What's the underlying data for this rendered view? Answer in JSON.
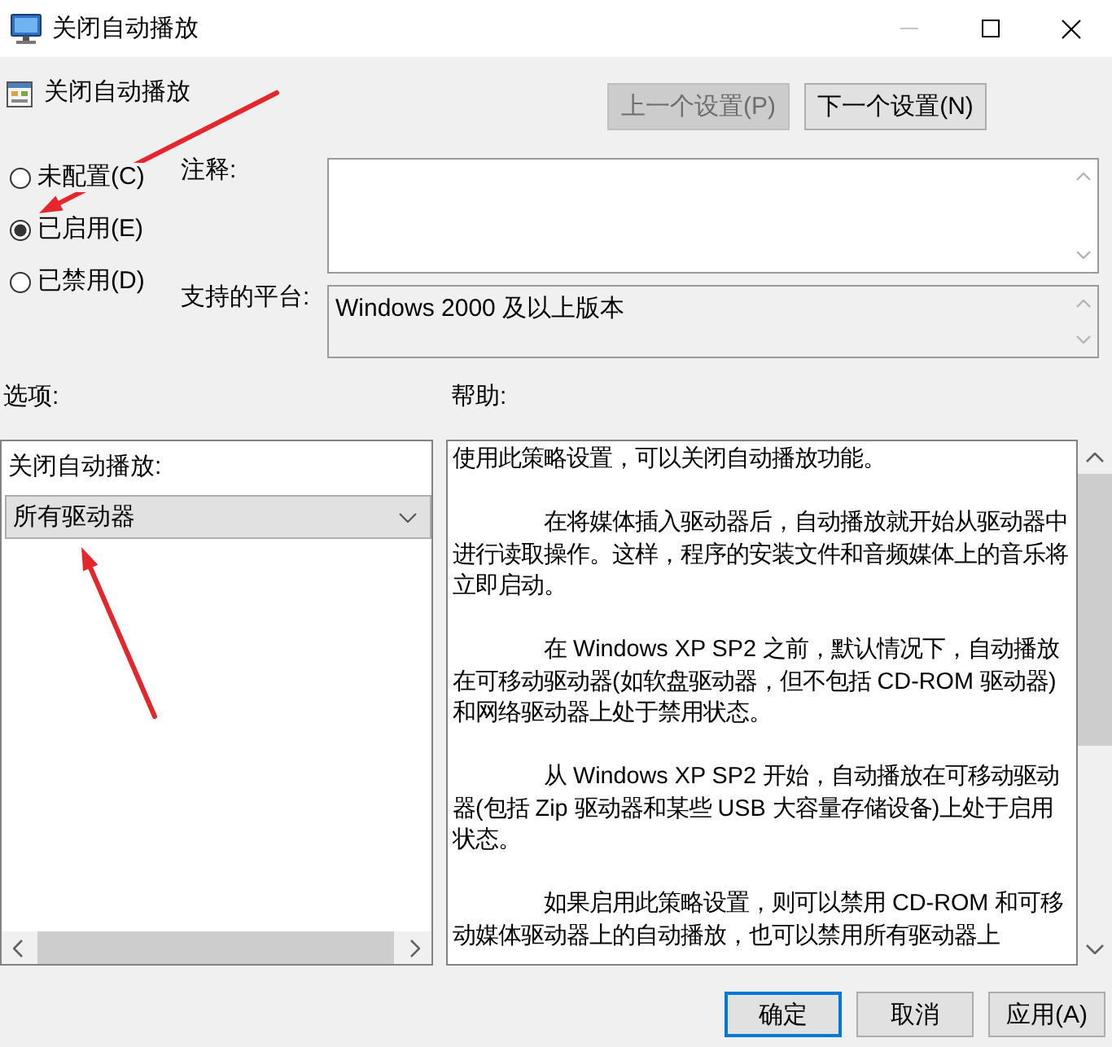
{
  "window": {
    "title": "关闭自动播放",
    "controls": [
      {
        "kind": "minimize",
        "disabled": true
      },
      {
        "kind": "maximize",
        "disabled": false
      },
      {
        "kind": "close",
        "disabled": false
      }
    ]
  },
  "policy": {
    "name": "关闭自动播放"
  },
  "nav_buttons": [
    {
      "label": "上一个设置(P)",
      "disabled": true
    },
    {
      "label": "下一个设置(N)",
      "disabled": false
    }
  ],
  "state_options": [
    {
      "label": "未配置(C)",
      "selected": false,
      "annotated": false
    },
    {
      "label": "已启用(E)",
      "selected": true,
      "annotated": true
    },
    {
      "label": "已禁用(D)",
      "selected": false,
      "annotated": false
    }
  ],
  "comment": {
    "label": "注释:"
  },
  "platform": {
    "label": "支持的平台:",
    "value": "Windows 2000 及以上版本"
  },
  "options": {
    "heading": "选项:",
    "label": "关闭自动播放:",
    "dropdown": {
      "value": "所有驱动器",
      "annotated": true
    }
  },
  "help": {
    "heading": "帮助:",
    "paragraphs": [
      "使用此策略设置，可以关闭自动播放功能。",
      "在将媒体插入驱动器后，自动播放就开始从驱动器中进行读取操作。这样，程序的安装文件和音频媒体上的音乐将立即启动。",
      "在 Windows XP SP2 之前，默认情况下，自动播放在可移动驱动器(如软盘驱动器，但不包括 CD-ROM 驱动器)和网络驱动器上处于禁用状态。",
      "从 Windows XP SP2 开始，自动播放在可移动驱动器(包括 Zip 驱动器和某些 USB 大容量存储设备)上处于启用状态。",
      "如果启用此策略设置，则可以禁用 CD-ROM 和可移动媒体驱动器上的自动播放，也可以禁用所有驱动器上"
    ]
  },
  "buttons": [
    {
      "label": "确定",
      "default": true
    },
    {
      "label": "取消",
      "default": false
    },
    {
      "label": "应用(A)",
      "default": false
    }
  ]
}
